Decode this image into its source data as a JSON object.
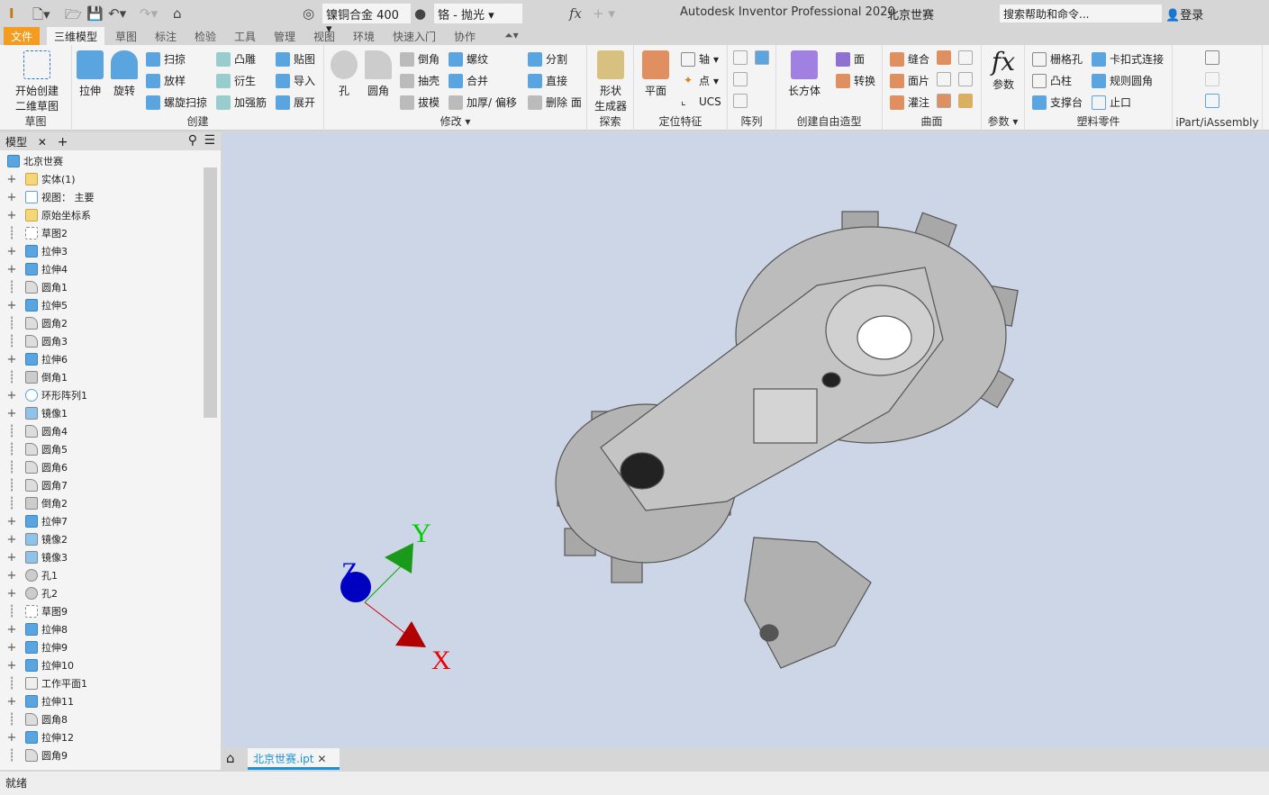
{
  "titlebar": {
    "app_title": "Autodesk Inventor Professional 2020",
    "doc_name": "北京世赛",
    "material": "镍铜合金 400",
    "appearance": "铬 - 抛光",
    "search_placeholder": "搜索帮助和命令...",
    "login": "登录",
    "fx": "fx"
  },
  "tabs": [
    "文件",
    "三维模型",
    "草图",
    "标注",
    "检验",
    "工具",
    "管理",
    "视图",
    "环境",
    "快速入门",
    "协作"
  ],
  "active_tab": "三维模型",
  "ribbon": {
    "sketch": {
      "label": "草图",
      "start": "开始创建",
      "start2": "二维草图"
    },
    "create": {
      "label": "创建",
      "extrude": "拉伸",
      "revolve": "旋转",
      "sweep": "扫掠",
      "loft": "放样",
      "coil": "螺旋扫掠",
      "emboss": "凸雕",
      "derive": "衍生",
      "rib": "加强筋",
      "decal": "贴图",
      "import": "导入",
      "unwrap": "展开"
    },
    "modify": {
      "label": "修改",
      "hole": "孔",
      "fillet": "圆角",
      "chamfer": "倒角",
      "shell": "抽壳",
      "draft": "拔模",
      "thread": "螺纹",
      "combine": "合并",
      "thicken": "加厚/ 偏移",
      "split": "分割",
      "direct": "直接",
      "delete_face": "删除 面"
    },
    "explore": {
      "label": "探索",
      "shape": "形状",
      "shape2": "生成器"
    },
    "work": {
      "label": "定位特征",
      "plane": "平面",
      "axis": "轴",
      "point": "点",
      "ucs": "UCS"
    },
    "pattern": {
      "label": "阵列"
    },
    "freeform": {
      "label": "创建自由造型",
      "box": "长方体",
      "face": "面",
      "convert": "转换"
    },
    "surface": {
      "label": "曲面",
      "stitch": "缝合",
      "patch": "面片",
      "sculpt": "灌注"
    },
    "params": {
      "label": "参数",
      "params": "参数"
    },
    "plastic": {
      "label": "塑料零件",
      "grill": "栅格孔",
      "boss": "凸柱",
      "rest": "支撑台",
      "snap": "卡扣式连接",
      "rule_fillet": "规则圆角",
      "lip": "止口"
    },
    "ipart": {
      "label": "iPart/iAssembly"
    }
  },
  "browser": {
    "tab": "模型",
    "root": "北京世赛",
    "items": [
      {
        "label": "实体(1)",
        "exp": true,
        "icon": "folder"
      },
      {
        "label": "视图： 主要",
        "exp": true,
        "icon": "view"
      },
      {
        "label": "原始坐标系",
        "exp": true,
        "icon": "folder"
      },
      {
        "label": "草图2",
        "exp": false,
        "icon": "sketch"
      },
      {
        "label": "拉伸3",
        "exp": true,
        "icon": "extrude"
      },
      {
        "label": "拉伸4",
        "exp": true,
        "icon": "extrude"
      },
      {
        "label": "圆角1",
        "exp": false,
        "icon": "fillet"
      },
      {
        "label": "拉伸5",
        "exp": true,
        "icon": "extrude"
      },
      {
        "label": "圆角2",
        "exp": false,
        "icon": "fillet"
      },
      {
        "label": "圆角3",
        "exp": false,
        "icon": "fillet"
      },
      {
        "label": "拉伸6",
        "exp": true,
        "icon": "extrude"
      },
      {
        "label": "倒角1",
        "exp": false,
        "icon": "chamfer"
      },
      {
        "label": "环形阵列1",
        "exp": true,
        "icon": "pattern"
      },
      {
        "label": "镜像1",
        "exp": true,
        "icon": "mirror"
      },
      {
        "label": "圆角4",
        "exp": false,
        "icon": "fillet"
      },
      {
        "label": "圆角5",
        "exp": false,
        "icon": "fillet"
      },
      {
        "label": "圆角6",
        "exp": false,
        "icon": "fillet"
      },
      {
        "label": "圆角7",
        "exp": false,
        "icon": "fillet"
      },
      {
        "label": "倒角2",
        "exp": false,
        "icon": "chamfer"
      },
      {
        "label": "拉伸7",
        "exp": true,
        "icon": "extrude"
      },
      {
        "label": "镜像2",
        "exp": true,
        "icon": "mirror"
      },
      {
        "label": "镜像3",
        "exp": true,
        "icon": "mirror"
      },
      {
        "label": "孔1",
        "exp": true,
        "icon": "hole"
      },
      {
        "label": "孔2",
        "exp": true,
        "icon": "hole"
      },
      {
        "label": "草图9",
        "exp": false,
        "icon": "sketch"
      },
      {
        "label": "拉伸8",
        "exp": true,
        "icon": "extrude"
      },
      {
        "label": "拉伸9",
        "exp": true,
        "icon": "extrude"
      },
      {
        "label": "拉伸10",
        "exp": true,
        "icon": "extrude"
      },
      {
        "label": "工作平面1",
        "exp": false,
        "icon": "plane"
      },
      {
        "label": "拉伸11",
        "exp": true,
        "icon": "extrude"
      },
      {
        "label": "圆角8",
        "exp": false,
        "icon": "fillet"
      },
      {
        "label": "拉伸12",
        "exp": true,
        "icon": "extrude"
      },
      {
        "label": "圆角9",
        "exp": false,
        "icon": "fillet"
      }
    ]
  },
  "viewport": {
    "axes": {
      "x": "X",
      "y": "Y",
      "z": "Z"
    },
    "colors": {
      "x": "#cc0000",
      "y": "#00aa00",
      "z": "#0000cc",
      "background": "#ccd6e6"
    }
  },
  "doc_tab": "北京世赛.ipt",
  "status": "就绪",
  "colors": {
    "file_tab": "#f39c1f",
    "accent": "#1e90d6"
  }
}
